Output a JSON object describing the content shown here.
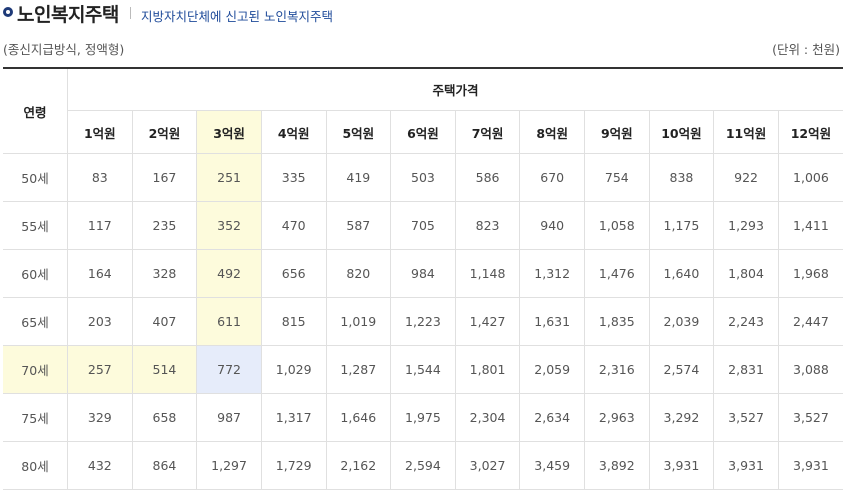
{
  "header": {
    "title": "노인복지주택",
    "subtitle": "지방자치단체에 신고된 노인복지주택"
  },
  "notes": {
    "left": "(종신지급방식, 정액형)",
    "right": "(단위 : 천원)"
  },
  "table": {
    "age_header": "연령",
    "group_header": "주택가격",
    "columns": [
      "1억원",
      "2억원",
      "3억원",
      "4억원",
      "5억원",
      "6억원",
      "7억원",
      "8억원",
      "9억원",
      "10억원",
      "11억원",
      "12억원"
    ],
    "rows": [
      {
        "age": "50세",
        "values": [
          "83",
          "167",
          "251",
          "335",
          "419",
          "503",
          "586",
          "670",
          "754",
          "838",
          "922",
          "1,006"
        ]
      },
      {
        "age": "55세",
        "values": [
          "117",
          "235",
          "352",
          "470",
          "587",
          "705",
          "823",
          "940",
          "1,058",
          "1,175",
          "1,293",
          "1,411"
        ]
      },
      {
        "age": "60세",
        "values": [
          "164",
          "328",
          "492",
          "656",
          "820",
          "984",
          "1,148",
          "1,312",
          "1,476",
          "1,640",
          "1,804",
          "1,968"
        ]
      },
      {
        "age": "65세",
        "values": [
          "203",
          "407",
          "611",
          "815",
          "1,019",
          "1,223",
          "1,427",
          "1,631",
          "1,835",
          "2,039",
          "2,243",
          "2,447"
        ]
      },
      {
        "age": "70세",
        "values": [
          "257",
          "514",
          "772",
          "1,029",
          "1,287",
          "1,544",
          "1,801",
          "2,059",
          "2,316",
          "2,574",
          "2,831",
          "3,088"
        ]
      },
      {
        "age": "75세",
        "values": [
          "329",
          "658",
          "987",
          "1,317",
          "1,646",
          "1,975",
          "2,304",
          "2,634",
          "2,963",
          "3,292",
          "3,527",
          "3,527"
        ]
      },
      {
        "age": "80세",
        "values": [
          "432",
          "864",
          "1,297",
          "1,729",
          "2,162",
          "2,594",
          "3,027",
          "3,459",
          "3,892",
          "3,931",
          "3,931",
          "3,931"
        ]
      }
    ],
    "highlight": {
      "row": 4,
      "col": 2,
      "colors": {
        "yellow": "#fdfbdc",
        "blue": "#e6ecfa"
      }
    }
  }
}
